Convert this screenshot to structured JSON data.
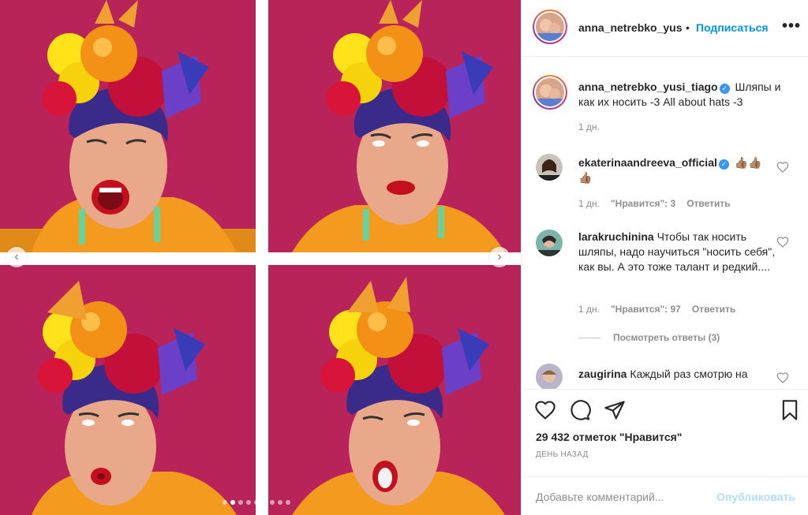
{
  "post": {
    "username": "anna_netrebko_yus",
    "separator": "•",
    "follow_label": "Подписаться",
    "more_icon": "more-options-icon",
    "caption": {
      "username": "anna_netrebko_yusi_tiago",
      "text": "Шляпы и как их носить -3 All about hats -3",
      "time": "1 дн."
    },
    "comments": [
      {
        "username": "ekaterinaandreeva_official",
        "verified": true,
        "text": "👍🏽👍🏽👍🏽",
        "time": "1 дн.",
        "likes": "\"Нравится\": 3",
        "reply": "Ответить"
      },
      {
        "username": "larakruchinina",
        "verified": false,
        "text": "Чтобы так носить шляпы, надо научиться \"носить себя\", как вы. А это тоже талант и редкий....",
        "time": "1 дн.",
        "likes": "\"Нравится\": 97",
        "reply": "Ответить",
        "view_replies": "Посмотреть ответы (3)"
      },
      {
        "username": "zaugirina",
        "verified": false,
        "text": "Каждый раз смотрю на"
      }
    ],
    "likes_count": "29 432 отметок \"Нравится\"",
    "date": "ДЕНЬ НАЗАД",
    "comment_placeholder": "Добавьте комментарий...",
    "publish_label": "Опубликовать",
    "carousel": {
      "current": 2,
      "total": 9
    },
    "colors": {
      "accent": "#0095f6",
      "muted": "#8e8e8e",
      "publish_disabled": "#b2dffc",
      "verified": "#3897f0",
      "backdrop": "#c42a62"
    }
  }
}
